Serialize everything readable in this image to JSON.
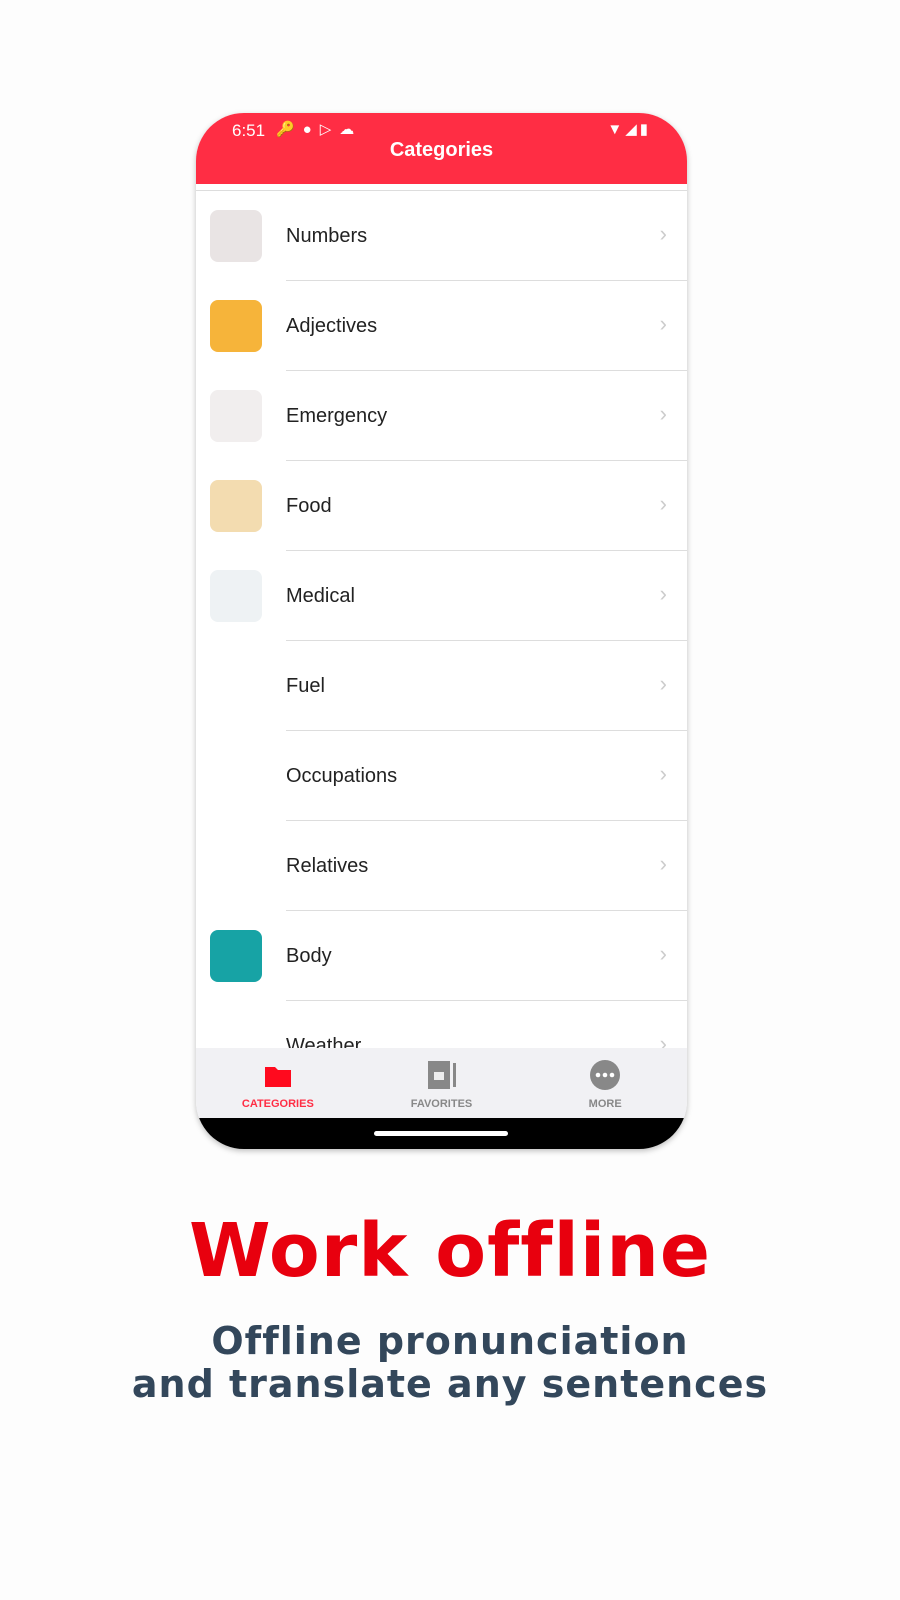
{
  "status_bar": {
    "time": "6:51"
  },
  "header": {
    "title": "Categories"
  },
  "categories": [
    {
      "label": "Numbers",
      "color": "#e9e4e4"
    },
    {
      "label": "Adjectives",
      "color": "#f6b43a"
    },
    {
      "label": "Emergency",
      "color": "#f1eeee"
    },
    {
      "label": "Food",
      "color": "#f3dcb0"
    },
    {
      "label": "Medical",
      "color": "#eef2f4"
    },
    {
      "label": "Fuel",
      "color": "#ffffff"
    },
    {
      "label": "Occupations",
      "color": "#ffffff"
    },
    {
      "label": "Relatives",
      "color": "#ffffff"
    },
    {
      "label": "Body",
      "color": "#17a3a5"
    },
    {
      "label": "Weather",
      "color": "#ffffff"
    }
  ],
  "tabs": [
    {
      "label": "CATEGORIES",
      "icon": "folder-icon"
    },
    {
      "label": "FAVORITES",
      "icon": "favorites-icon"
    },
    {
      "label": "MORE",
      "icon": "more-icon"
    }
  ],
  "promo": {
    "title": "Work offline",
    "subtitle_line1": "Offline pronunciation",
    "subtitle_line2": "and translate any sentences"
  },
  "colors": {
    "accent": "#FF2D44",
    "title": "#E8000E",
    "subtitle": "#33475B"
  }
}
